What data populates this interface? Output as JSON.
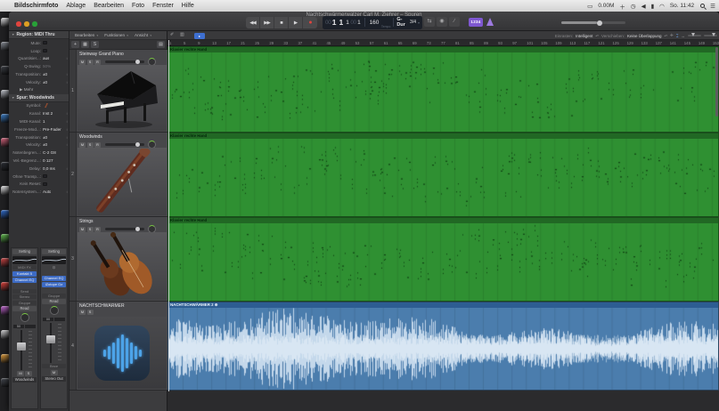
{
  "colors": {
    "accent_blue": "#3d6bc4",
    "region_green": "#2f9032",
    "region_green_header": "#1f6b22",
    "audio_blue": "#4b7dad",
    "audio_header": "#2d5d92",
    "waveform": "#d9e8f6",
    "count_in_purple": "#7e57d0",
    "record_red": "#e0443e",
    "metronome_purple": "#9d7ae0"
  },
  "menubar": {
    "apple": "",
    "items": [
      "Bildschirmfoto",
      "Ablage",
      "Bearbeiten",
      "Foto",
      "Fenster",
      "Hilfe"
    ],
    "status": {
      "display_icon": "▭",
      "net_rate": "0.00M",
      "input_icon": "＋",
      "clock_icon": "◷",
      "volume_icon": "◀",
      "battery_icon": "▮",
      "wifi_icon": "◠",
      "clock": "So. 11:42",
      "menu_icon": "☰"
    }
  },
  "window": {
    "title": "Nachtschwärmerwalzer Carl M. Ziehrer – Spuren"
  },
  "transport": {
    "rewind": "◀◀",
    "forward": "▶▶",
    "stop": "■",
    "play": "▶",
    "record": "●"
  },
  "lcd": {
    "pos_dim": "00",
    "bar": "1",
    "beat": "1",
    "div": "1",
    "tick_dim": "00",
    "tick": "1",
    "pos_label": "Takt",
    "tempo": "160",
    "tempo_label": "Tempo",
    "key": "G-Dur",
    "time_sig": "3/4",
    "caret": "▾"
  },
  "toolbar_right": {
    "cycle_icon": "⇆",
    "autopunch_icon": "◉",
    "replace_icon": "∕",
    "lowlatency_icon": "▭",
    "count_in": "1234"
  },
  "inspector": {
    "region_header": "Region: MIDI Thru",
    "region_rows": [
      {
        "label": "Mute:",
        "type": "checkbox"
      },
      {
        "label": "Loop:",
        "type": "checkbox"
      },
      {
        "label": "Quantisier...:",
        "value": "aus",
        "stepper": true
      },
      {
        "label": "Q-Swing:",
        "value": "50%",
        "dim": true
      },
      {
        "label": "Transposition:",
        "value": "±0",
        "stepper": true
      },
      {
        "label": "Velocity:",
        "value": "±0",
        "stepper": true
      },
      {
        "label": "Mehr",
        "type": "disclosure"
      }
    ],
    "track_header": "Spur: Woodwinds",
    "track_rows": [
      {
        "label": "Symbol:",
        "type": "symbol"
      },
      {
        "label": "Kanal:",
        "value": "Inst 2",
        "stepper": true
      },
      {
        "label": "MIDI-Kanal:",
        "value": "1",
        "stepper": true
      },
      {
        "label": "Freeze-Mod...:",
        "value": "Pre-Fader",
        "stepper": true
      },
      {
        "label": "Transposition:",
        "value": "±0",
        "stepper": true
      },
      {
        "label": "Velocity:",
        "value": "±0",
        "stepper": true
      },
      {
        "label": "Notenbegren...:",
        "value": "C-2  G8"
      },
      {
        "label": "Vel.-Begrenz...:",
        "value": "0  127"
      },
      {
        "label": "Delay:",
        "value": "0,0 ms",
        "stepper": true
      },
      {
        "label": "Ohne Transp...:",
        "type": "checkbox"
      },
      {
        "label": "Kein Reset:",
        "type": "checkbox"
      },
      {
        "label": "Notensystem...:",
        "value": "Auto",
        "stepper": true
      }
    ]
  },
  "strips": [
    {
      "name": "Woodwinds",
      "items": [
        {
          "t": "btn",
          "v": "Setting"
        },
        {
          "t": "eq"
        },
        {
          "t": "dim",
          "v": "MIDI FX"
        },
        {
          "t": "plug",
          "v": "Kontakt 5"
        },
        {
          "t": "plug",
          "v": "Channel EQ"
        },
        {
          "t": "gap"
        },
        {
          "t": "dim",
          "v": "Send"
        },
        {
          "t": "dim",
          "v": "Stereo"
        },
        {
          "t": "dim",
          "v": "Gruppe"
        },
        {
          "t": "btn",
          "v": "Read"
        },
        {
          "t": "knob"
        },
        {
          "t": "val",
          "v": "50"
        },
        {
          "t": "fader"
        },
        {
          "t": "ms",
          "v": [
            "M",
            "S"
          ]
        },
        {
          "t": "name",
          "v": "Woodwinds"
        }
      ]
    },
    {
      "name": "Stereo Out",
      "items": [
        {
          "t": "btn",
          "v": "Setting"
        },
        {
          "t": "eq"
        },
        {
          "t": "eye",
          "v": "⊙"
        },
        {
          "t": "gap"
        },
        {
          "t": "plug",
          "v": "Channel EQ"
        },
        {
          "t": "plug",
          "v": "iZotope Oz"
        },
        {
          "t": "gap"
        },
        {
          "t": "dim",
          "v": "Gruppe"
        },
        {
          "t": "btn",
          "v": "Read"
        },
        {
          "t": "knob"
        },
        {
          "t": "val",
          "v": "00"
        },
        {
          "t": "fader"
        },
        {
          "t": "dim",
          "v": "Bnce"
        },
        {
          "t": "ms",
          "v": [
            "M"
          ]
        },
        {
          "t": "name",
          "v": "Stereo Out"
        }
      ]
    }
  ],
  "track_area": {
    "menus": [
      "Bearbeiten",
      "Funktionen",
      "Ansicht"
    ],
    "buttons": {
      "add": "+",
      "dup": "▦",
      "solo": "S",
      "right_icon": "▤"
    },
    "tracks": [
      {
        "num": "1",
        "name": "Steinway Grand Piano",
        "buttons": [
          "M",
          "S",
          "R"
        ],
        "image": "piano"
      },
      {
        "num": "2",
        "name": "Woodwinds",
        "buttons": [
          "M",
          "S",
          "R"
        ],
        "image": "bassoon"
      },
      {
        "num": "3",
        "name": "Strings",
        "buttons": [
          "M",
          "S",
          "R"
        ],
        "image": "strings"
      },
      {
        "num": "4",
        "name": "NACHTSCHWÄRMER",
        "buttons": [
          "M",
          "S"
        ],
        "image": "audio"
      }
    ]
  },
  "arrange": {
    "left_icons": {
      "pencil": "✐",
      "bracket": "▥"
    },
    "snap_label": "Einrasten:",
    "snap_value": "Intelligent",
    "drag_label": "Verschieben:",
    "drag_value": "Keine Überlappung",
    "tool_icons": {
      "pointer_plus": "✛",
      "marquee": "⌶",
      "zoom_fit": "↔"
    },
    "ruler_labels": [
      1,
      5,
      9,
      13,
      17,
      21,
      25,
      29,
      33,
      37,
      41,
      45,
      49,
      53,
      57,
      61,
      65,
      69,
      73,
      77,
      81,
      85,
      89,
      93,
      97,
      101,
      105,
      109,
      113,
      117,
      121,
      125,
      129,
      133,
      137,
      141,
      145,
      149,
      153
    ],
    "regions": [
      {
        "name": "Klavier rechte Hand",
        "kind": "midi"
      },
      {
        "name": "Klavier rechte Hand",
        "kind": "midi"
      },
      {
        "name": "Klavier rechte Hand",
        "kind": "midi"
      },
      {
        "name": "NACHTSCHWÄRMER 2",
        "kind": "audio",
        "badge": "⊕"
      }
    ]
  },
  "dock_colors": [
    "#e8e8ea",
    "#8a8f98",
    "#3a3d44",
    "#c8ccd4",
    "#3b82d0",
    "#e06680",
    "#2a2d34",
    "#f0f0f2",
    "#2e6fd6",
    "#62c34e",
    "#d64545",
    "#e8423c",
    "#c867d8",
    "#d8d8da",
    "#e8a23c",
    "#44484f"
  ]
}
